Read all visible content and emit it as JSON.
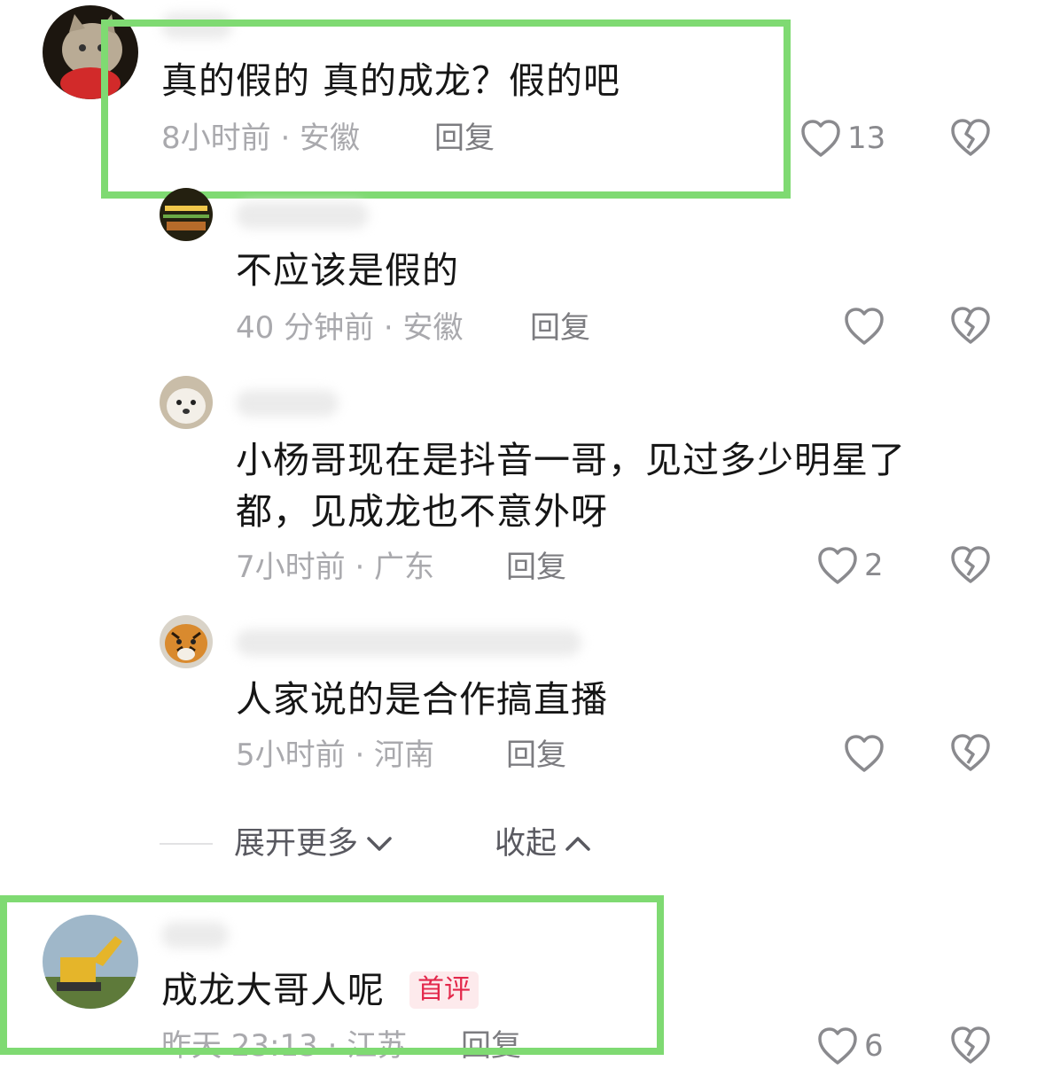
{
  "comments": [
    {
      "text": "真的假的 真的成龙？假的吧",
      "meta": "8小时前 · 安徽",
      "reply_label": "回复",
      "likes": "13",
      "avatar": "cat-avatar"
    }
  ],
  "replies": [
    {
      "text": "不应该是假的",
      "meta": "40 分钟前 · 安徽",
      "reply_label": "回复",
      "likes": "",
      "avatar": "lights-avatar"
    },
    {
      "text": "小杨哥现在是抖音一哥，见过多少明星了都，见成龙也不意外呀",
      "meta": "7小时前 · 广东",
      "reply_label": "回复",
      "likes": "2",
      "avatar": "dog-avatar"
    },
    {
      "text": "人家说的是合作搞直播",
      "meta": "5小时前 · 河南",
      "reply_label": "回复",
      "likes": "",
      "avatar": "tiger-avatar"
    }
  ],
  "controls": {
    "expand_more": "展开更多",
    "collapse": "收起"
  },
  "second_comment": {
    "text": "成龙大哥人呢",
    "badge": "首评",
    "meta": "昨天 23:13 · 江苏",
    "reply_label": "回复",
    "likes": "6",
    "avatar": "excavator-avatar"
  },
  "colors": {
    "highlight": "#7fda72",
    "badge_text": "#e3284b",
    "badge_bg": "#fdeaec"
  }
}
